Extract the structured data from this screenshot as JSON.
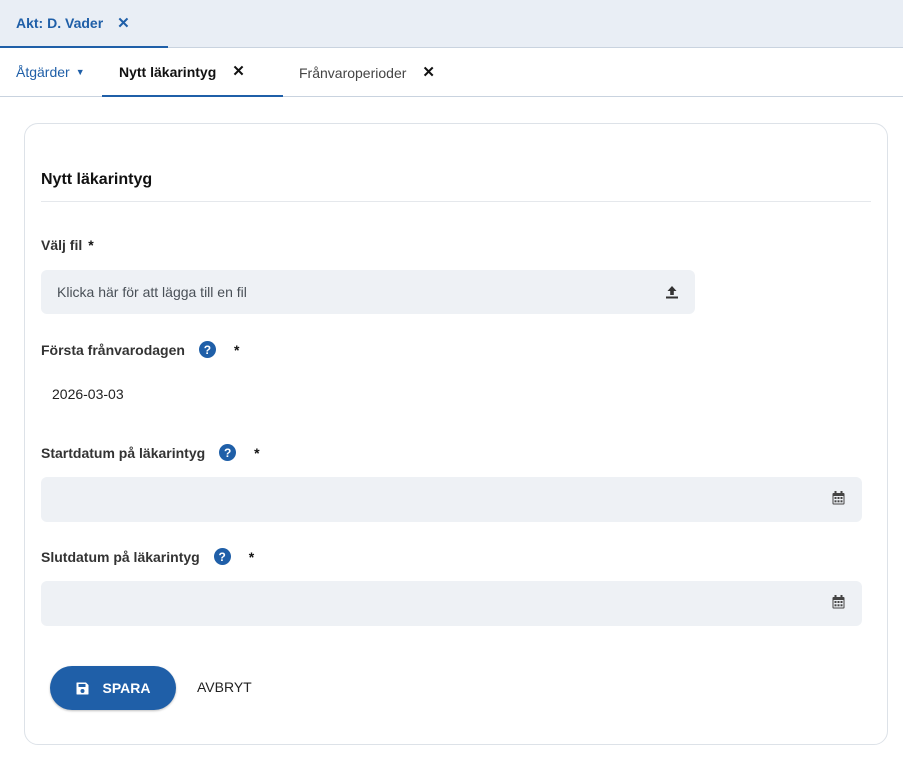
{
  "top_tabs": [
    {
      "label": "Akt: D. Vader",
      "active": true
    }
  ],
  "sub_nav": {
    "actions_label": "Åtgärder",
    "tabs": [
      {
        "label": "Nytt läkarintyg",
        "active": true
      },
      {
        "label": "Frånvaroperioder",
        "active": false
      }
    ]
  },
  "form": {
    "title": "Nytt läkarintyg",
    "file": {
      "label": "Välj fil",
      "required_mark": "*",
      "placeholder": "Klicka här för att lägga till en fil",
      "icon": "upload-icon"
    },
    "first_absence_day": {
      "label": "Första frånvarodagen",
      "required_mark": "*",
      "help_icon": "?",
      "value": "2026-03-03"
    },
    "start_date": {
      "label": "Startdatum på läkarintyg",
      "required_mark": "*",
      "help_icon": "?",
      "value": "",
      "icon": "calendar-icon"
    },
    "end_date": {
      "label": "Slutdatum på läkarintyg",
      "required_mark": "*",
      "help_icon": "?",
      "value": "",
      "icon": "calendar-icon"
    },
    "save_label": "SPARA",
    "cancel_label": "AVBRYT"
  },
  "colors": {
    "primary": "#1f5fa8",
    "field_bg": "#eef1f5",
    "topbar_bg": "#e9eef5"
  }
}
